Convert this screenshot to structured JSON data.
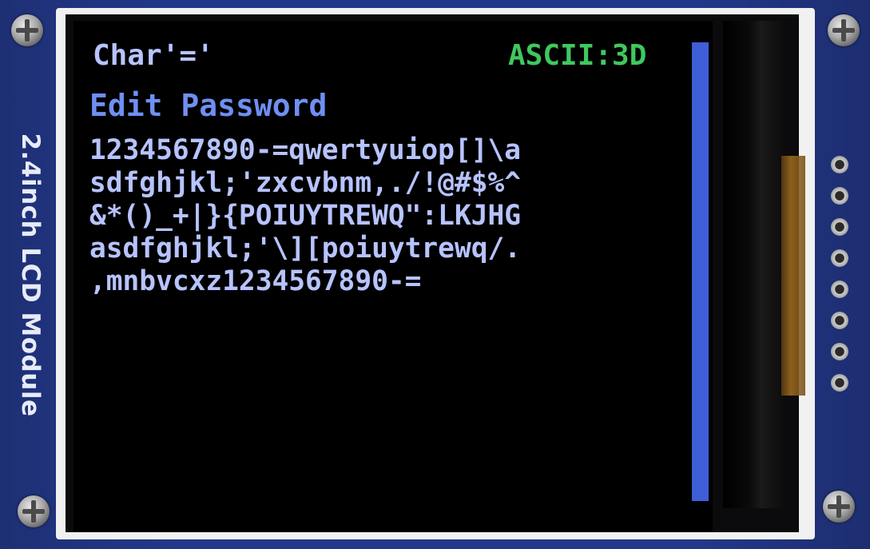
{
  "module": {
    "silkscreen_label": "2.4inch LCD Module",
    "screw_icon": "screw-icon",
    "header_pins": 8
  },
  "screen": {
    "char_display": "Char'='",
    "ascii_display": "ASCII:3D",
    "title": "Edit Password",
    "password_lines": [
      "1234567890-=qwertyuiop[]\\a",
      "sdfghjkl;'zxcvbnm,./!@#$%^",
      "&*()_+|}{POIUYTREWQ\":LKJHG",
      "asdfghjkl;'\\][poiuytrewq/.",
      ",mnbvcxz1234567890-="
    ]
  },
  "colors": {
    "pcb": "#23388a",
    "text_primary": "#b8c4ff",
    "title": "#6f8ff2",
    "ascii": "#3fc85f",
    "scrollbar": "#3f5fd8",
    "background": "#000000"
  }
}
